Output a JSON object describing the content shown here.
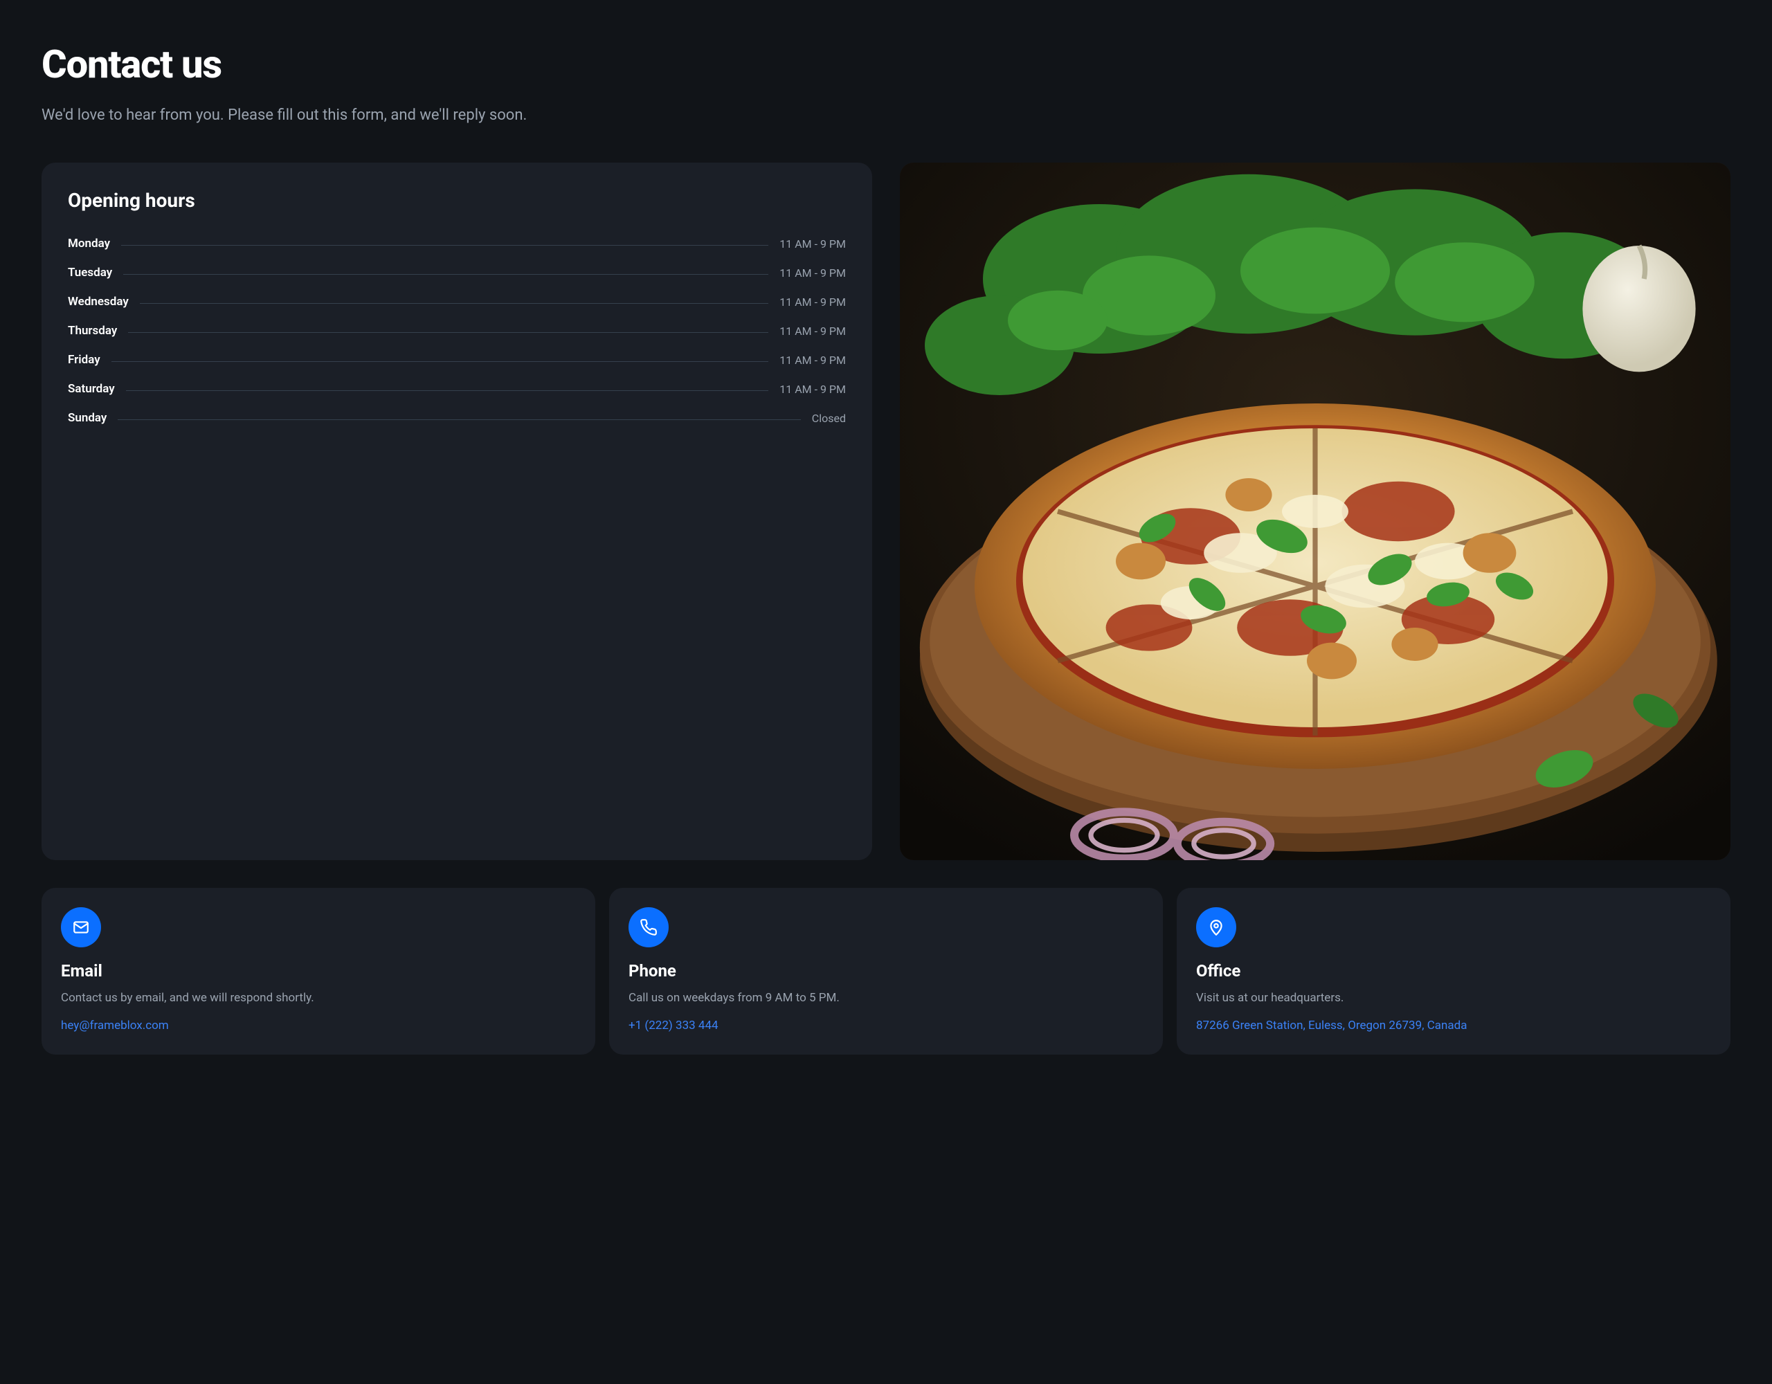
{
  "header": {
    "title": "Contact us",
    "subtitle": "We'd love to hear from you. Please fill out this form, and we'll reply soon."
  },
  "opening_hours": {
    "title": "Opening hours",
    "rows": [
      {
        "day": "Monday",
        "time": "11 AM - 9 PM"
      },
      {
        "day": "Tuesday",
        "time": "11 AM - 9 PM"
      },
      {
        "day": "Wednesday",
        "time": "11 AM - 9 PM"
      },
      {
        "day": "Thursday",
        "time": "11 AM - 9 PM"
      },
      {
        "day": "Friday",
        "time": "11 AM - 9 PM"
      },
      {
        "day": "Saturday",
        "time": "11 AM - 9 PM"
      },
      {
        "day": "Sunday",
        "time": "Closed"
      }
    ]
  },
  "contact_cards": [
    {
      "icon": "mail-icon",
      "title": "Email",
      "desc": "Contact us by email, and we will respond shortly.",
      "link": "hey@frameblox.com"
    },
    {
      "icon": "phone-icon",
      "title": "Phone",
      "desc": "Call us on weekdays from 9 AM to 5 PM.",
      "link": "+1 (222) 333 444"
    },
    {
      "icon": "pin-icon",
      "title": "Office",
      "desc": "Visit us at our headquarters.",
      "link": "87266 Green Station, Euless, Oregon 26739, Canada"
    }
  ]
}
